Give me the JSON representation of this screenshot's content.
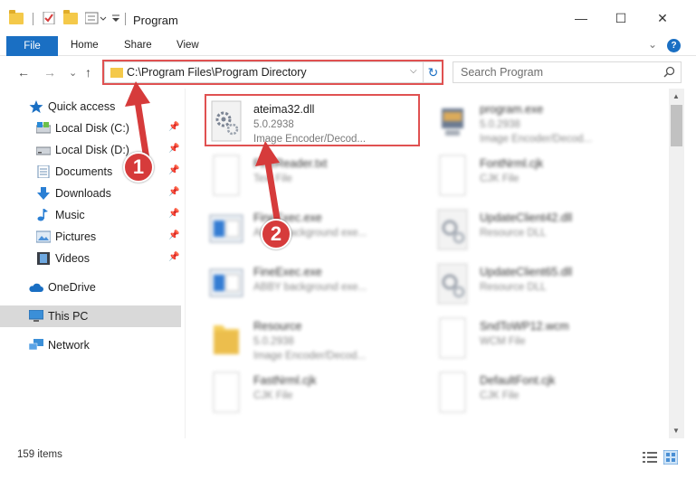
{
  "window": {
    "title": "Program",
    "minimize": "—",
    "maximize": "☐",
    "close": "✕"
  },
  "ribbon": {
    "tabs": [
      "File",
      "Home",
      "Share",
      "View"
    ],
    "collapse": "⌄",
    "help": "?"
  },
  "address_bar": {
    "path": "C:\\Program Files\\Program Directory",
    "dropdown": "⌵",
    "refresh": "↻"
  },
  "search": {
    "placeholder": "Search Program"
  },
  "nav_buttons": {
    "back": "←",
    "forward": "→",
    "dropdown": "⌄",
    "up": "↑"
  },
  "sidebar": {
    "quick_access": "Quick access",
    "items": [
      {
        "label": "Local Disk (C:)",
        "icon": "drive-icon"
      },
      {
        "label": "Local Disk (D:)",
        "icon": "drive-icon"
      },
      {
        "label": "Documents",
        "icon": "documents-icon"
      },
      {
        "label": "Downloads",
        "icon": "downloads-icon"
      },
      {
        "label": "Music",
        "icon": "music-icon"
      },
      {
        "label": "Pictures",
        "icon": "pictures-icon"
      },
      {
        "label": "Videos",
        "icon": "videos-icon"
      }
    ],
    "onedrive": "OneDrive",
    "this_pc": "This PC",
    "network": "Network"
  },
  "files": [
    {
      "name": "ateima32.dll",
      "line1": "5.0.2938",
      "line2": "Image Encoder/Decod...",
      "type": "gear"
    },
    {
      "name": "program.exe",
      "line1": "5.0.2938",
      "line2": "Image Encoder/Decod...",
      "type": "app"
    },
    {
      "name": "FineReader.txt",
      "line1": "Text File",
      "line2": "",
      "type": "doc"
    },
    {
      "name": "FontNrml.cjk",
      "line1": "CJK File",
      "line2": "",
      "type": "doc"
    },
    {
      "name": "FineExec.exe",
      "line1": "ABBY background exe...",
      "line2": "",
      "type": "window"
    },
    {
      "name": "UpdateClient42.dll",
      "line1": "Resource DLL",
      "line2": "",
      "type": "gear"
    },
    {
      "name": "FineExec.exe",
      "line1": "ABBY background exe...",
      "line2": "",
      "type": "window"
    },
    {
      "name": "UpdateClient65.dll",
      "line1": "Resource DLL",
      "line2": "",
      "type": "gear"
    },
    {
      "name": "Resource",
      "line1": "5.0.2938",
      "line2": "Image Encoder/Decod...",
      "type": "folder"
    },
    {
      "name": "SndToWP12.wcm",
      "line1": "WCM File",
      "line2": "",
      "type": "doc"
    },
    {
      "name": "FastNrml.cjk",
      "line1": "CJK File",
      "line2": "",
      "type": "doc"
    },
    {
      "name": "DefaultFont.cjk",
      "line1": "CJK File",
      "line2": "",
      "type": "doc"
    }
  ],
  "status": {
    "count": "159 items"
  },
  "annotations": {
    "step1": "1",
    "step2": "2"
  },
  "colors": {
    "accent": "#1a6fc3",
    "highlight": "#e05151",
    "badge": "#d63b3b"
  }
}
